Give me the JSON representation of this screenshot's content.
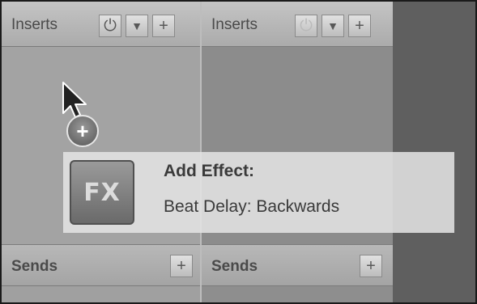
{
  "channels": [
    {
      "inserts_label": "Inserts",
      "power_icon": "power-icon",
      "dropdown_icon": "chevron-down-icon",
      "add_icon": "plus-icon",
      "sends_label": "Sends",
      "send_add_icon": "plus-icon"
    },
    {
      "inserts_label": "Inserts",
      "power_icon": "power-icon",
      "dropdown_icon": "chevron-down-icon",
      "add_icon": "plus-icon",
      "sends_label": "Sends",
      "send_add_icon": "plus-icon"
    }
  ],
  "drag_badge_icon": "plus-circle-icon",
  "tooltip": {
    "icon_text": "FX",
    "title": "Add Effect:",
    "subtitle": "Beat Delay: Backwards"
  }
}
